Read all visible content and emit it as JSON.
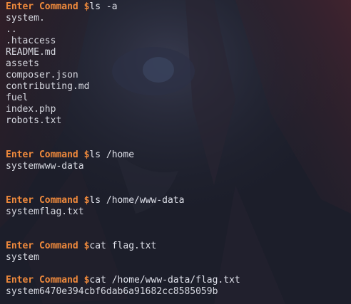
{
  "colors": {
    "prompt": "#f08a3c",
    "output": "#d6d8e0",
    "background": "#1c1e2a"
  },
  "prompt_text": "Enter Command $",
  "blocks": [
    {
      "command": "ls -a",
      "output": [
        "system.",
        "..",
        ".htaccess",
        "README.md",
        "assets",
        "composer.json",
        "contributing.md",
        "fuel",
        "index.php",
        "robots.txt"
      ]
    },
    {
      "command": "ls /home",
      "output": [
        "systemwww-data"
      ]
    },
    {
      "command": "ls /home/www-data",
      "output": [
        "systemflag.txt"
      ]
    },
    {
      "command": "cat flag.txt",
      "output": [
        "system"
      ]
    },
    {
      "command": "cat /home/www-data/flag.txt",
      "output": [
        "system6470e394cbf6dab6a91682cc8585059b"
      ]
    }
  ]
}
